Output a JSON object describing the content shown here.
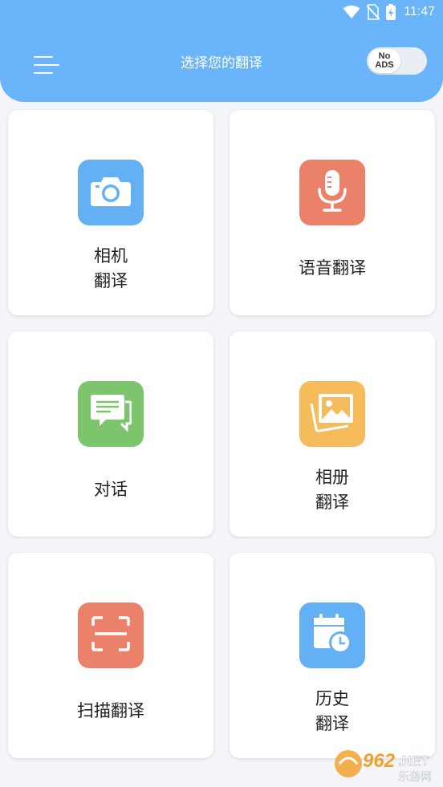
{
  "status_bar": {
    "time": "11:47"
  },
  "header": {
    "title": "选择您的翻译",
    "toggle": {
      "line1": "No",
      "line2": "ADS"
    }
  },
  "cards": [
    {
      "lines": [
        "相机",
        "翻译"
      ],
      "icon": "camera-icon",
      "color": "#64b0f5"
    },
    {
      "lines": [
        "语音翻译"
      ],
      "icon": "microphone-icon",
      "color": "#ea8168"
    },
    {
      "lines": [
        "对话"
      ],
      "icon": "chat-icon",
      "color": "#7cc56c"
    },
    {
      "lines": [
        "相册",
        "翻译"
      ],
      "icon": "gallery-icon",
      "color": "#f6bb5a"
    },
    {
      "lines": [
        "扫描翻译"
      ],
      "icon": "scan-icon",
      "color": "#ea8168"
    },
    {
      "lines": [
        "历史",
        "翻译"
      ],
      "icon": "history-icon",
      "color": "#64b0f5"
    }
  ],
  "watermark": {
    "number": "962",
    "suffix": ".NET",
    "sub": "乐游网"
  }
}
